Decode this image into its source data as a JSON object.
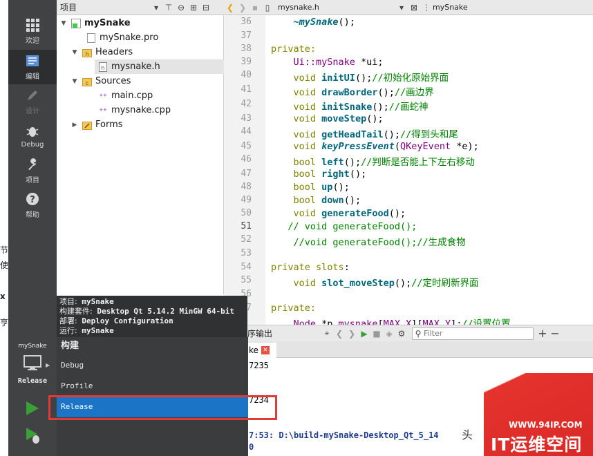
{
  "edge_text": [
    "节",
    "使",
    "x",
    "亨"
  ],
  "modes": [
    {
      "label": "欢迎",
      "icon": "grid-icon"
    },
    {
      "label": "编辑",
      "icon": "edit-document-icon"
    },
    {
      "label": "设计",
      "icon": "pen-icon"
    },
    {
      "label": "Debug",
      "icon": "bug-icon"
    },
    {
      "label": "项目",
      "icon": "wrench-icon"
    },
    {
      "label": "帮助",
      "icon": "help-icon"
    }
  ],
  "project_pane": {
    "title": "项目"
  },
  "editor_header": {
    "file": "mysnake.h",
    "symbol": "mySnake"
  },
  "tree": {
    "root": "mySnake",
    "pro": "mySnake.pro",
    "headers": "Headers",
    "header_file": "mysnake.h",
    "sources": "Sources",
    "main": "main.cpp",
    "snake_cpp": "mysnake.cpp",
    "forms": "Forms"
  },
  "code_lines": [
    {
      "n": "36"
    },
    {
      "n": "37"
    },
    {
      "n": "38"
    },
    {
      "n": "39"
    },
    {
      "n": "40"
    },
    {
      "n": "41"
    },
    {
      "n": "42"
    },
    {
      "n": "43"
    },
    {
      "n": "44"
    },
    {
      "n": "45"
    },
    {
      "n": "46"
    },
    {
      "n": "47"
    },
    {
      "n": "48"
    },
    {
      "n": "49"
    },
    {
      "n": "50"
    },
    {
      "n": "51"
    },
    {
      "n": "52"
    },
    {
      "n": "53"
    },
    {
      "n": "54"
    },
    {
      "n": "55"
    },
    {
      "n": "56"
    },
    {
      "n": "57"
    }
  ],
  "code": {
    "l36_fn": "~mySnake",
    "l36_rest": "();",
    "l38": "private:",
    "l39_ns": "Ui::mySnake",
    "l39_rest": " *ui;",
    "void": "void",
    "bool": "bool",
    "l40_fn": "initUI",
    "l40_cm": "//初始化原始界面",
    "l41_fn": "drawBorder",
    "l41_cm": "//画边界",
    "l42_fn": "initSnake",
    "l42_cm": "//画蛇神",
    "l43_fn": "moveStep",
    "l44_fn": "getHeadTail",
    "l44_cm": "//得到头和尾",
    "l45_fn": "keyPressEvent",
    "l45_ty": "QKeyEvent",
    "l45_rest": " *e);",
    "l46_fn": "left",
    "l46_cm": "//判断是否能上下左右移动",
    "l47_fn": "right",
    "l48_fn": "up",
    "l49_fn": "down",
    "l50_fn": "generateFood",
    "l51_cm": "// void generateFood();",
    "l52_cm": "//void generateFood();//生成食物",
    "l54_kw": "private",
    "l54_slots": "slots",
    "l55_fn": "slot_moveStep",
    "l55_cm": "//定时刷新界面",
    "l57_ty": "Node",
    "l57_rest": " *p ",
    "l57_id": "mysnake",
    "l57_m1": "MAX_X",
    "l57_m2": "MAX_Y",
    "l57_cm": "//设置位置",
    "semi": "();"
  },
  "output": {
    "toolbar_title": "序输出",
    "filter_placeholder": "Filter",
    "tab_label": "ke",
    "close": "✕",
    "lines": [
      "7235",
      "7234",
      "7:53: D:\\build-mySnake-Desktop_Qt_5_14",
      "0"
    ],
    "overflow_text": "头"
  },
  "kit_panel": {
    "project": "mySnake",
    "config": "Release"
  },
  "tooltip": {
    "project_key": "项目:",
    "project_val": "mySnake",
    "kit_key": "构建套件:",
    "kit_val": "Desktop Qt 5.14.2 MinGW 64-bit",
    "deploy_key": "部署:",
    "deploy_val": "Deploy Configuration",
    "run_key": "运行:",
    "run_val": "mySnake"
  },
  "build_menu": {
    "header": "构建",
    "items": [
      "Debug",
      "Profile",
      "Release"
    ],
    "selected": "Release"
  },
  "watermark": {
    "url": "WWW.94IP.COM",
    "name": "IT运维空间"
  },
  "colors": {
    "accent": "#1b74c5",
    "highlight": "#e23b36",
    "sidebar": "#404244"
  }
}
